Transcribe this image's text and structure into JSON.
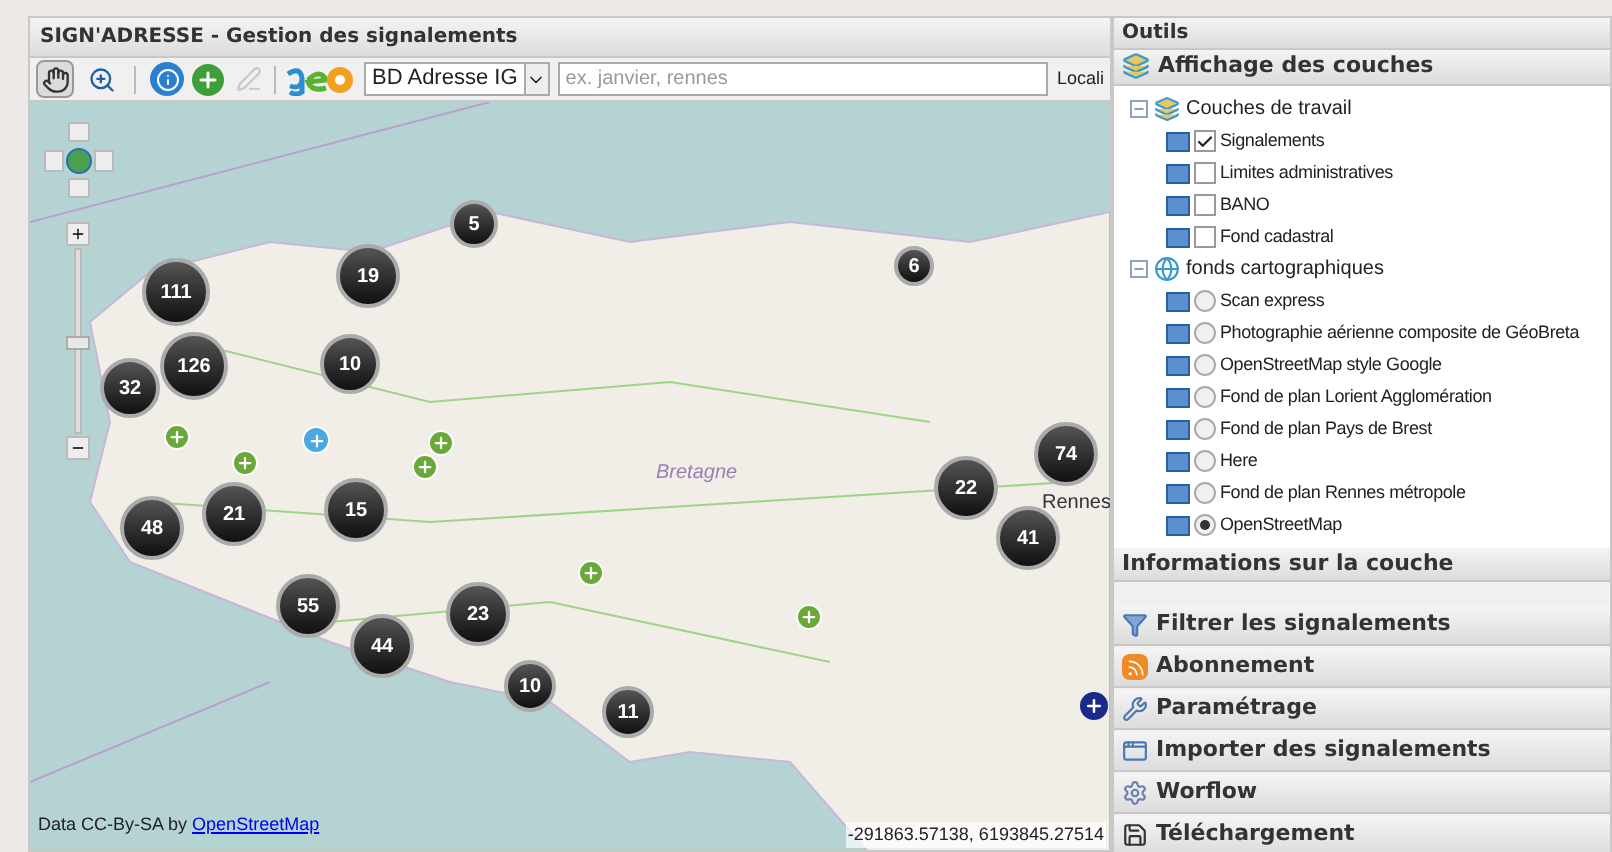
{
  "map_panel": {
    "title": "SIGN'ADRESSE - Gestion des signalements",
    "toolbar": {
      "tools": [
        {
          "kind": "pan",
          "selected": true
        },
        {
          "kind": "zoom",
          "selected": false
        }
      ],
      "source_select": "BD Adresse IG",
      "search": {
        "placeholder": "ex. janvier, rennes"
      },
      "locate_button": "Locali"
    },
    "zoom_slider": {
      "level": 0.5
    },
    "clusters": [
      {
        "count": "5"
      },
      {
        "count": "111"
      },
      {
        "count": "19"
      },
      {
        "count": "6"
      },
      {
        "count": "126"
      },
      {
        "count": "10"
      },
      {
        "count": "32"
      },
      {
        "count": "74"
      },
      {
        "count": "22"
      },
      {
        "count": "48"
      },
      {
        "count": "21"
      },
      {
        "count": "15"
      },
      {
        "count": "41"
      },
      {
        "count": "55"
      },
      {
        "count": "23"
      },
      {
        "count": "44"
      },
      {
        "count": "10"
      },
      {
        "count": "11"
      }
    ],
    "places": [
      "Bretagne",
      "Rennes"
    ],
    "attribution": {
      "text": "Data CC-By-SA by",
      "link": "OpenStreetMap"
    },
    "coordinates": "-291863.57138, 6193845.27514"
  },
  "tools_panel": {
    "title": "Outils",
    "layers_section": "Affichage des couches",
    "layers": [
      {
        "label": "Couches de travail",
        "kind": "folder",
        "expanded": true,
        "children": [
          {
            "label": "Signalements",
            "kind": "checkbox",
            "checked": true
          },
          {
            "label": "Limites administratives",
            "kind": "checkbox",
            "checked": false
          },
          {
            "label": "BANO",
            "kind": "checkbox",
            "checked": false
          },
          {
            "label": "Fond cadastral",
            "kind": "checkbox",
            "checked": false
          }
        ]
      },
      {
        "label": "fonds cartographiques",
        "kind": "globe",
        "expanded": true,
        "children": [
          {
            "label": "Scan express",
            "kind": "radio",
            "checked": false
          },
          {
            "label": "Photographie aérienne composite de GéoBreta",
            "kind": "radio",
            "checked": false
          },
          {
            "label": "OpenStreetMap style Google",
            "kind": "radio",
            "checked": false
          },
          {
            "label": "Fond de plan Lorient Agglomération",
            "kind": "radio",
            "checked": false
          },
          {
            "label": "Fond de plan Pays de Brest",
            "kind": "radio",
            "checked": false
          },
          {
            "label": "Here",
            "kind": "radio",
            "checked": false
          },
          {
            "label": "Fond de plan Rennes métropole",
            "kind": "radio",
            "checked": false
          },
          {
            "label": "OpenStreetMap",
            "kind": "radio",
            "checked": true
          }
        ]
      }
    ],
    "info_section": "Informations sur la couche",
    "sections": [
      {
        "label": "Filtrer les signalements",
        "kind": "filter"
      },
      {
        "label": "Abonnement",
        "kind": "rss"
      },
      {
        "label": "Paramétrage",
        "kind": "tools"
      },
      {
        "label": "Importer des signalements",
        "kind": "window"
      },
      {
        "label": "Worflow",
        "kind": "gear"
      },
      {
        "label": "Téléchargement",
        "kind": "save"
      }
    ]
  }
}
